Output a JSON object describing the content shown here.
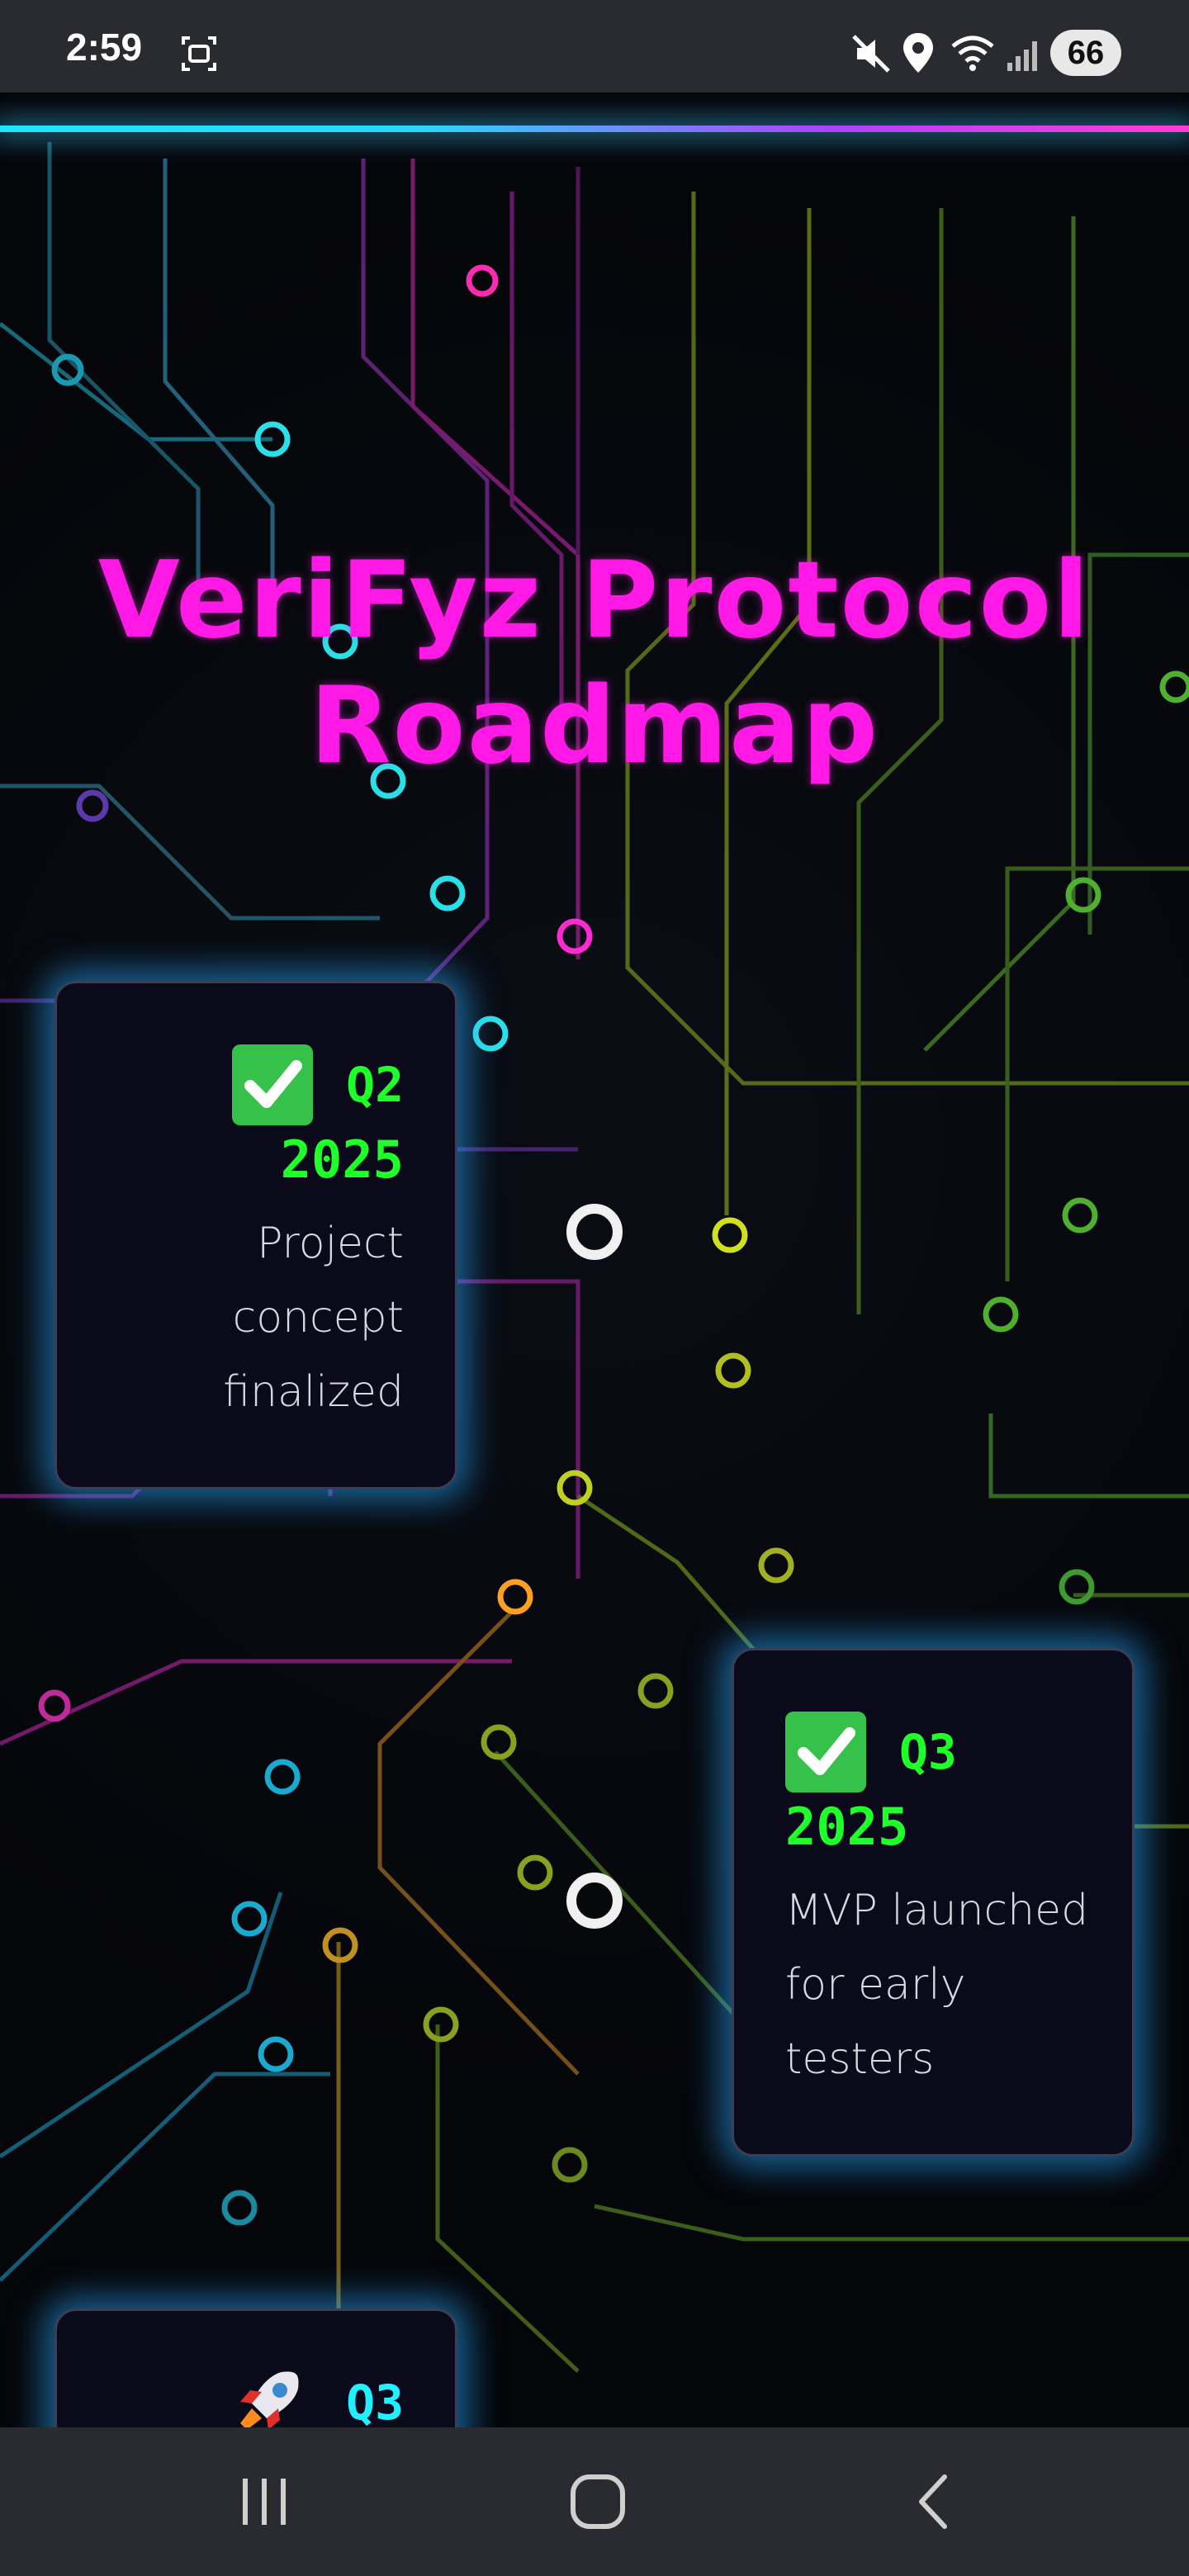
{
  "status_bar": {
    "time": "2:59",
    "battery": "66",
    "icons": [
      "screenshot-icon",
      "mute-icon",
      "location-icon",
      "wifi-icon",
      "signal-icon"
    ]
  },
  "page": {
    "title_line1": "VeriFyz Protocol",
    "title_line2": "Roadmap"
  },
  "roadmap": {
    "items": [
      {
        "icon": "check-mark-icon",
        "quarter": "Q2",
        "year": "2025",
        "desc_lines": [
          "Project",
          "concept",
          "finalized"
        ]
      },
      {
        "icon": "check-mark-icon",
        "quarter": "Q3",
        "year": "2025",
        "desc_lines": [
          "MVP launched",
          "for early",
          "testers"
        ]
      },
      {
        "icon": "rocket-icon",
        "quarter": "Q3"
      }
    ]
  },
  "colors": {
    "title": "#ff18e6",
    "date_green": "#1fff2a",
    "date_cyan": "#20f0ff",
    "card_glow": "#28aaff"
  },
  "nav_bar": {
    "buttons": [
      "recents-icon",
      "home-icon",
      "back-icon"
    ]
  }
}
